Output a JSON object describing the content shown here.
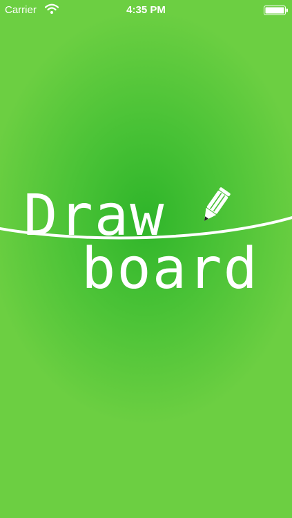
{
  "status_bar": {
    "carrier": "Carrier",
    "time": "4:35 PM",
    "wifi_icon": "wifi-icon",
    "battery_icon": "battery-icon"
  },
  "logo": {
    "line1": "Draw",
    "line2": "board",
    "pencil_icon": "pencil-icon"
  },
  "colors": {
    "background_center": "#2fb52a",
    "background_edge": "#6ccf42",
    "foreground": "#ffffff"
  }
}
